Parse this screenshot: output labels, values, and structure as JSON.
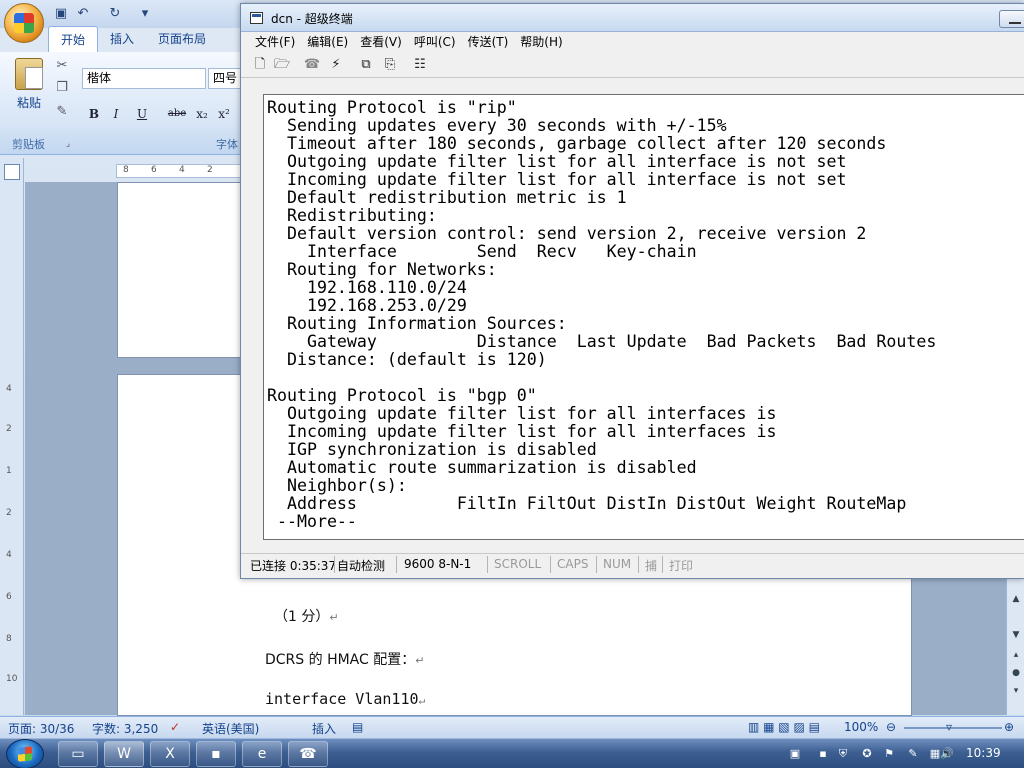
{
  "word": {
    "tabs": [
      "开始",
      "插入",
      "页面布局"
    ],
    "clipboard": {
      "paste_label": "粘贴",
      "group_label": "剪贴板"
    },
    "font": {
      "family": "楷体",
      "size": "四号",
      "group_label": "字体"
    },
    "format_buttons": [
      "B",
      "I",
      "U",
      "abe",
      "x₂",
      "x²"
    ],
    "ruler_h_ticks": [
      "8",
      "6",
      "4",
      "2"
    ],
    "ruler_v_ticks": [
      "4",
      "2",
      "1",
      "2",
      "4",
      "6",
      "8",
      "10"
    ],
    "document_lines": [
      {
        "text": "（1 分）"
      },
      {
        "text": "DCRS 的 HMAC 配置："
      },
      {
        "text": "interface Vlan110"
      }
    ],
    "status": {
      "page": "页面: 30/36",
      "words": "字数: 3,250",
      "language": "英语(美国)",
      "insert": "插入",
      "zoom": "100%"
    }
  },
  "terminal": {
    "title": "dcn - 超级终端",
    "menu": [
      "文件(F)",
      "编辑(E)",
      "查看(V)",
      "呼叫(C)",
      "传送(T)",
      "帮助(H)"
    ],
    "lines": [
      "Routing Protocol is \"rip\"",
      "  Sending updates every 30 seconds with +/-15%",
      "  Timeout after 180 seconds, garbage collect after 120 seconds",
      "  Outgoing update filter list for all interface is not set",
      "  Incoming update filter list for all interface is not set",
      "  Default redistribution metric is 1",
      "  Redistributing:",
      "  Default version control: send version 2, receive version 2",
      "    Interface        Send  Recv   Key-chain",
      "  Routing for Networks:",
      "    192.168.110.0/24",
      "    192.168.253.0/29",
      "  Routing Information Sources:",
      "    Gateway          Distance  Last Update  Bad Packets  Bad Routes",
      "  Distance: (default is 120)",
      "",
      "Routing Protocol is \"bgp 0\"",
      "  Outgoing update filter list for all interfaces is",
      "  Incoming update filter list for all interfaces is",
      "  IGP synchronization is disabled",
      "  Automatic route summarization is disabled",
      "  Neighbor(s):",
      "  Address          FiltIn FiltOut DistIn DistOut Weight RouteMap",
      " --More--"
    ],
    "status": {
      "connected": "已连接 0:35:37",
      "detect": "自动检测",
      "port": "9600 8-N-1",
      "scroll": "SCROLL",
      "caps": "CAPS",
      "num": "NUM",
      "capture": "捕",
      "print": "打印"
    }
  },
  "taskbar": {
    "clock": "10:39"
  }
}
